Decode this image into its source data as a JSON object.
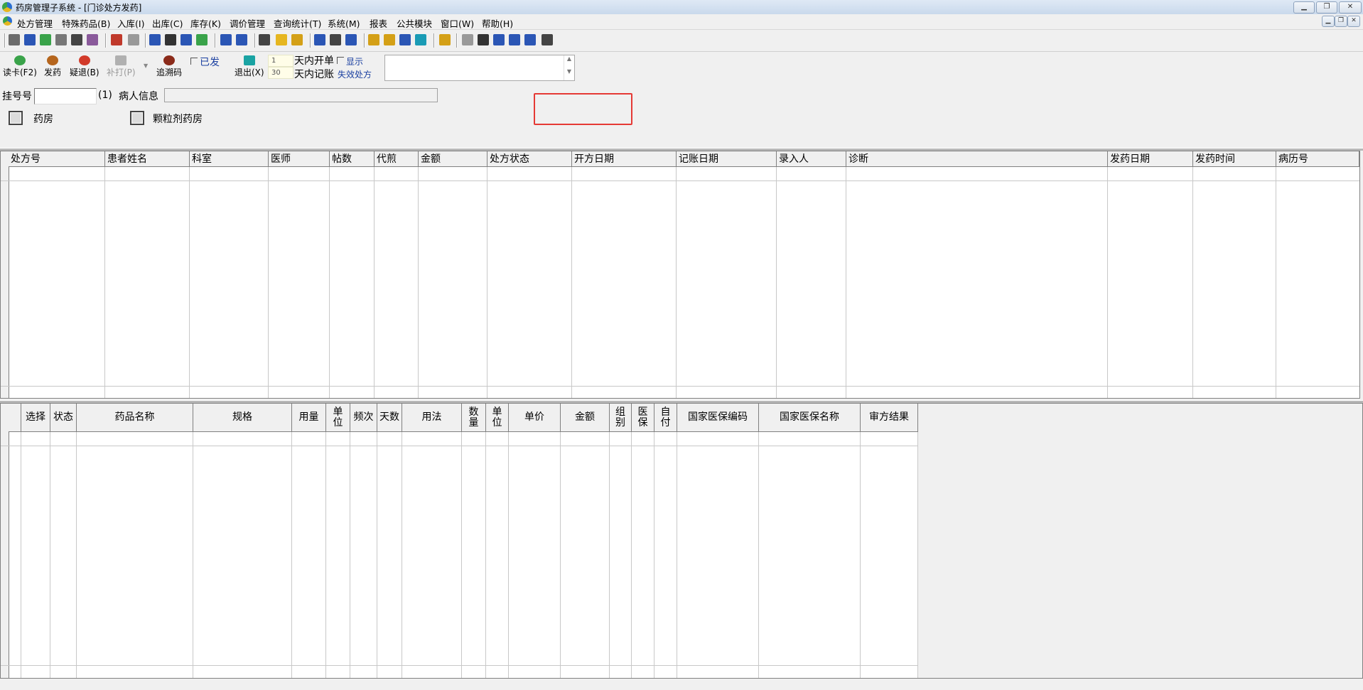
{
  "window": {
    "title": "药房管理子系统 - [门诊处方发药]"
  },
  "menu": [
    "处方管理",
    "特殊药品(B)",
    "入库(I)",
    "出库(C)",
    "库存(K)",
    "调价管理",
    "查询统计(T)",
    "系统(M)",
    "报表",
    "公共模块",
    "窗口(W)",
    "帮助(H)"
  ],
  "actions": {
    "read_card": "读卡(F2)",
    "dispense": "发药",
    "return_doubt": "疑退(B)",
    "reprint": "补打(P)",
    "trace_code": "追溯码",
    "dispensed_check": "已发",
    "exit": "退出(X)"
  },
  "filters": {
    "days_open_value": "1",
    "days_open_label": "天内开单",
    "show_label": "显示",
    "days_bill_value": "30",
    "days_bill_label": "天内记账",
    "invalid_label": "失效处方"
  },
  "patient": {
    "reg_label": "挂号号",
    "reg_value": "",
    "count_label": "(1)",
    "info_label": "病人信息",
    "info_value": ""
  },
  "pharmacy": {
    "opt1": "药房",
    "opt2": "颗粒剂药房"
  },
  "prescription_grid": {
    "columns": [
      "处方号",
      "患者姓名",
      "科室",
      "医师",
      "帖数",
      "代煎",
      "金额",
      "处方状态",
      "开方日期",
      "记账日期",
      "录入人",
      "诊断",
      "发药日期",
      "发药时间",
      "病历号"
    ]
  },
  "detail_grid": {
    "columns": [
      "选择",
      "状态",
      "药品名称",
      "规格",
      "用量",
      "单位",
      "频次",
      "天数",
      "用法",
      "数量",
      "单位",
      "单价",
      "金额",
      "组别",
      "医保",
      "自付",
      "国家医保编码",
      "国家医保名称",
      "审方结果"
    ]
  }
}
